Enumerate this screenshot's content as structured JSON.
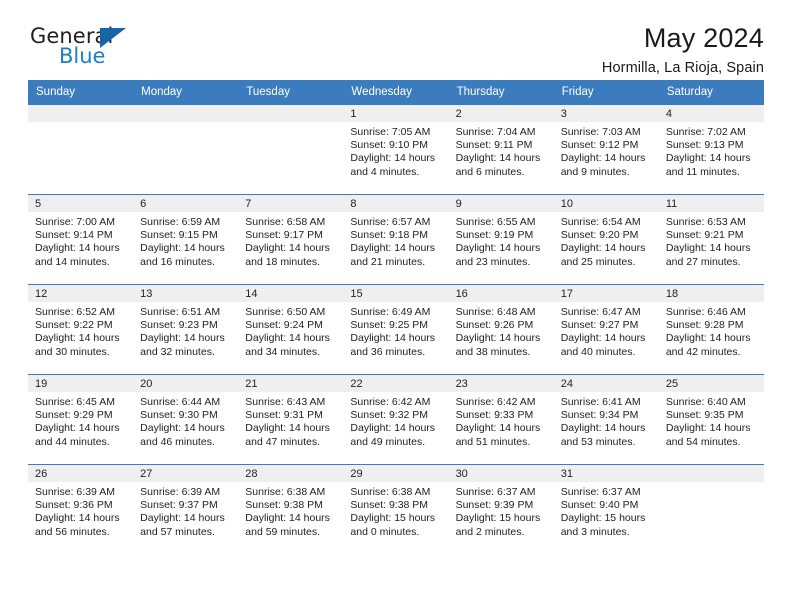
{
  "brand": {
    "name_primary": "General",
    "name_secondary": "Blue",
    "triangle_icon": "triangle-icon",
    "accent_color": "#1b7fc4",
    "header_color": "#3a7cbe"
  },
  "header": {
    "title": "May 2024",
    "subtitle": "Hormilla, La Rioja, Spain"
  },
  "calendar": {
    "weekday_headers": [
      "Sunday",
      "Monday",
      "Tuesday",
      "Wednesday",
      "Thursday",
      "Friday",
      "Saturday"
    ],
    "weeks": [
      [
        {
          "day": "",
          "empty": true
        },
        {
          "day": "",
          "empty": true
        },
        {
          "day": "",
          "empty": true
        },
        {
          "day": "1",
          "sunrise": "Sunrise: 7:05 AM",
          "sunset": "Sunset: 9:10 PM",
          "daylight_line1": "Daylight: 14 hours",
          "daylight_line2": "and 4 minutes."
        },
        {
          "day": "2",
          "sunrise": "Sunrise: 7:04 AM",
          "sunset": "Sunset: 9:11 PM",
          "daylight_line1": "Daylight: 14 hours",
          "daylight_line2": "and 6 minutes."
        },
        {
          "day": "3",
          "sunrise": "Sunrise: 7:03 AM",
          "sunset": "Sunset: 9:12 PM",
          "daylight_line1": "Daylight: 14 hours",
          "daylight_line2": "and 9 minutes."
        },
        {
          "day": "4",
          "sunrise": "Sunrise: 7:02 AM",
          "sunset": "Sunset: 9:13 PM",
          "daylight_line1": "Daylight: 14 hours",
          "daylight_line2": "and 11 minutes."
        }
      ],
      [
        {
          "day": "5",
          "sunrise": "Sunrise: 7:00 AM",
          "sunset": "Sunset: 9:14 PM",
          "daylight_line1": "Daylight: 14 hours",
          "daylight_line2": "and 14 minutes."
        },
        {
          "day": "6",
          "sunrise": "Sunrise: 6:59 AM",
          "sunset": "Sunset: 9:15 PM",
          "daylight_line1": "Daylight: 14 hours",
          "daylight_line2": "and 16 minutes."
        },
        {
          "day": "7",
          "sunrise": "Sunrise: 6:58 AM",
          "sunset": "Sunset: 9:17 PM",
          "daylight_line1": "Daylight: 14 hours",
          "daylight_line2": "and 18 minutes."
        },
        {
          "day": "8",
          "sunrise": "Sunrise: 6:57 AM",
          "sunset": "Sunset: 9:18 PM",
          "daylight_line1": "Daylight: 14 hours",
          "daylight_line2": "and 21 minutes."
        },
        {
          "day": "9",
          "sunrise": "Sunrise: 6:55 AM",
          "sunset": "Sunset: 9:19 PM",
          "daylight_line1": "Daylight: 14 hours",
          "daylight_line2": "and 23 minutes."
        },
        {
          "day": "10",
          "sunrise": "Sunrise: 6:54 AM",
          "sunset": "Sunset: 9:20 PM",
          "daylight_line1": "Daylight: 14 hours",
          "daylight_line2": "and 25 minutes."
        },
        {
          "day": "11",
          "sunrise": "Sunrise: 6:53 AM",
          "sunset": "Sunset: 9:21 PM",
          "daylight_line1": "Daylight: 14 hours",
          "daylight_line2": "and 27 minutes."
        }
      ],
      [
        {
          "day": "12",
          "sunrise": "Sunrise: 6:52 AM",
          "sunset": "Sunset: 9:22 PM",
          "daylight_line1": "Daylight: 14 hours",
          "daylight_line2": "and 30 minutes."
        },
        {
          "day": "13",
          "sunrise": "Sunrise: 6:51 AM",
          "sunset": "Sunset: 9:23 PM",
          "daylight_line1": "Daylight: 14 hours",
          "daylight_line2": "and 32 minutes."
        },
        {
          "day": "14",
          "sunrise": "Sunrise: 6:50 AM",
          "sunset": "Sunset: 9:24 PM",
          "daylight_line1": "Daylight: 14 hours",
          "daylight_line2": "and 34 minutes."
        },
        {
          "day": "15",
          "sunrise": "Sunrise: 6:49 AM",
          "sunset": "Sunset: 9:25 PM",
          "daylight_line1": "Daylight: 14 hours",
          "daylight_line2": "and 36 minutes."
        },
        {
          "day": "16",
          "sunrise": "Sunrise: 6:48 AM",
          "sunset": "Sunset: 9:26 PM",
          "daylight_line1": "Daylight: 14 hours",
          "daylight_line2": "and 38 minutes."
        },
        {
          "day": "17",
          "sunrise": "Sunrise: 6:47 AM",
          "sunset": "Sunset: 9:27 PM",
          "daylight_line1": "Daylight: 14 hours",
          "daylight_line2": "and 40 minutes."
        },
        {
          "day": "18",
          "sunrise": "Sunrise: 6:46 AM",
          "sunset": "Sunset: 9:28 PM",
          "daylight_line1": "Daylight: 14 hours",
          "daylight_line2": "and 42 minutes."
        }
      ],
      [
        {
          "day": "19",
          "sunrise": "Sunrise: 6:45 AM",
          "sunset": "Sunset: 9:29 PM",
          "daylight_line1": "Daylight: 14 hours",
          "daylight_line2": "and 44 minutes."
        },
        {
          "day": "20",
          "sunrise": "Sunrise: 6:44 AM",
          "sunset": "Sunset: 9:30 PM",
          "daylight_line1": "Daylight: 14 hours",
          "daylight_line2": "and 46 minutes."
        },
        {
          "day": "21",
          "sunrise": "Sunrise: 6:43 AM",
          "sunset": "Sunset: 9:31 PM",
          "daylight_line1": "Daylight: 14 hours",
          "daylight_line2": "and 47 minutes."
        },
        {
          "day": "22",
          "sunrise": "Sunrise: 6:42 AM",
          "sunset": "Sunset: 9:32 PM",
          "daylight_line1": "Daylight: 14 hours",
          "daylight_line2": "and 49 minutes."
        },
        {
          "day": "23",
          "sunrise": "Sunrise: 6:42 AM",
          "sunset": "Sunset: 9:33 PM",
          "daylight_line1": "Daylight: 14 hours",
          "daylight_line2": "and 51 minutes."
        },
        {
          "day": "24",
          "sunrise": "Sunrise: 6:41 AM",
          "sunset": "Sunset: 9:34 PM",
          "daylight_line1": "Daylight: 14 hours",
          "daylight_line2": "and 53 minutes."
        },
        {
          "day": "25",
          "sunrise": "Sunrise: 6:40 AM",
          "sunset": "Sunset: 9:35 PM",
          "daylight_line1": "Daylight: 14 hours",
          "daylight_line2": "and 54 minutes."
        }
      ],
      [
        {
          "day": "26",
          "sunrise": "Sunrise: 6:39 AM",
          "sunset": "Sunset: 9:36 PM",
          "daylight_line1": "Daylight: 14 hours",
          "daylight_line2": "and 56 minutes."
        },
        {
          "day": "27",
          "sunrise": "Sunrise: 6:39 AM",
          "sunset": "Sunset: 9:37 PM",
          "daylight_line1": "Daylight: 14 hours",
          "daylight_line2": "and 57 minutes."
        },
        {
          "day": "28",
          "sunrise": "Sunrise: 6:38 AM",
          "sunset": "Sunset: 9:38 PM",
          "daylight_line1": "Daylight: 14 hours",
          "daylight_line2": "and 59 minutes."
        },
        {
          "day": "29",
          "sunrise": "Sunrise: 6:38 AM",
          "sunset": "Sunset: 9:38 PM",
          "daylight_line1": "Daylight: 15 hours",
          "daylight_line2": "and 0 minutes."
        },
        {
          "day": "30",
          "sunrise": "Sunrise: 6:37 AM",
          "sunset": "Sunset: 9:39 PM",
          "daylight_line1": "Daylight: 15 hours",
          "daylight_line2": "and 2 minutes."
        },
        {
          "day": "31",
          "sunrise": "Sunrise: 6:37 AM",
          "sunset": "Sunset: 9:40 PM",
          "daylight_line1": "Daylight: 15 hours",
          "daylight_line2": "and 3 minutes."
        },
        {
          "day": "",
          "empty": true
        }
      ]
    ]
  }
}
